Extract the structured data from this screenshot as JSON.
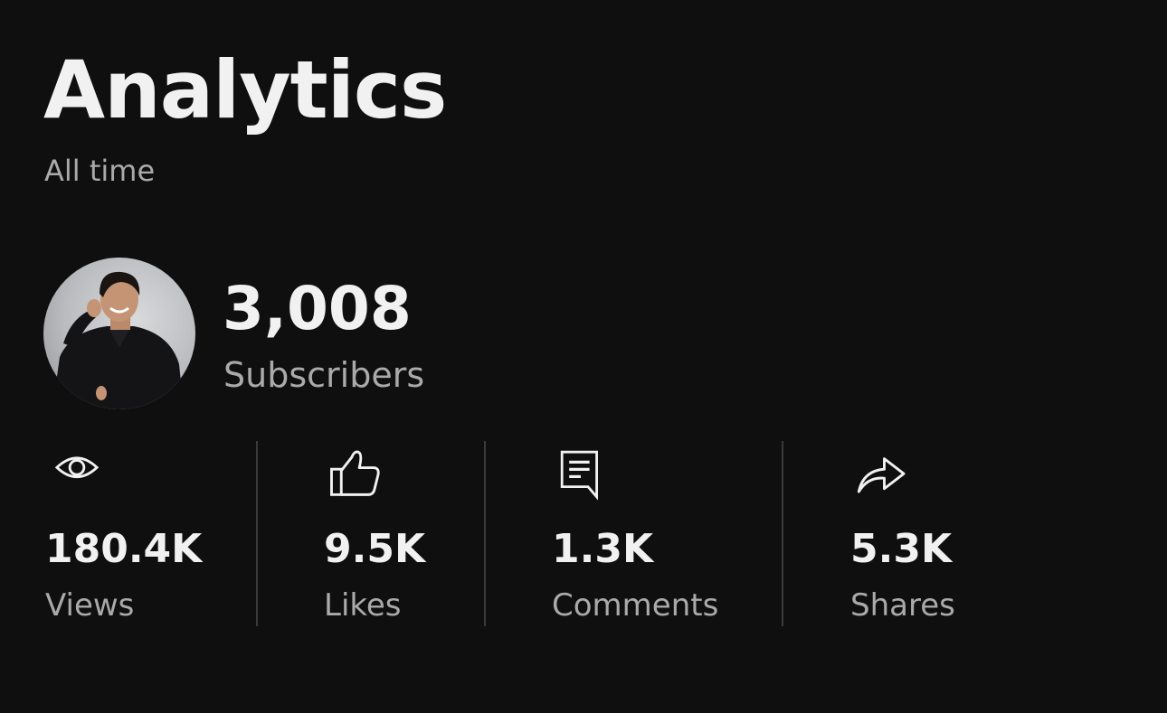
{
  "header": {
    "title": "Analytics",
    "subtitle": "All time"
  },
  "channel": {
    "subscriber_count": "3,008",
    "subscriber_label": "Subscribers"
  },
  "stats": [
    {
      "icon": "eye-icon",
      "value": "180.4K",
      "label": "Views"
    },
    {
      "icon": "thumbs-up-icon",
      "value": "9.5K",
      "label": "Likes"
    },
    {
      "icon": "comment-icon",
      "value": "1.3K",
      "label": "Comments"
    },
    {
      "icon": "share-icon",
      "value": "5.3K",
      "label": "Shares"
    }
  ],
  "colors": {
    "background": "#0f0f0f",
    "primary_text": "#f1f1f1",
    "secondary_text": "#aaaaaa",
    "divider": "#3a3a3a"
  }
}
